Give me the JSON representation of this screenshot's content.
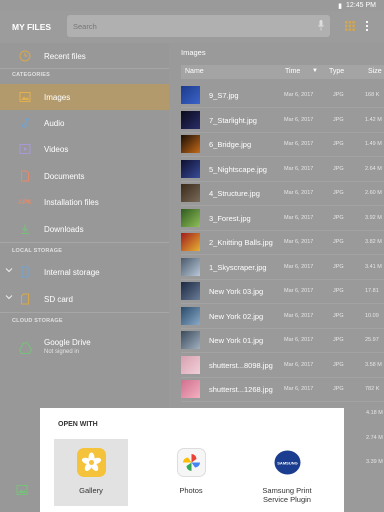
{
  "status": {
    "time": "12:45 PM"
  },
  "appbar": {
    "title": "MY FILES",
    "search_placeholder": "Search"
  },
  "sidebar": {
    "recent": "Recent files",
    "categories_head": "CATEGORIES",
    "categories": [
      "Images",
      "Audio",
      "Videos",
      "Documents",
      "Installation files",
      "Downloads"
    ],
    "apk_label": "APK",
    "local_head": "LOCAL STORAGE",
    "internal": "Internal storage",
    "sdcard": "SD card",
    "cloud_head": "CLOUD STORAGE",
    "gdrive": "Google Drive",
    "gdrive_sub": "Not signed in"
  },
  "main": {
    "breadcrumb": "Images",
    "columns": {
      "name": "Name",
      "time": "Time",
      "type": "Type",
      "size": "Size"
    },
    "files": [
      {
        "name": "9_S7.jpg",
        "date": "Mar 6, 2017",
        "type": "JPG",
        "size": "168 K"
      },
      {
        "name": "7_Starlight.jpg",
        "date": "Mar 6, 2017",
        "type": "JPG",
        "size": "1.42 M"
      },
      {
        "name": "6_Bridge.jpg",
        "date": "Mar 6, 2017",
        "type": "JPG",
        "size": "1.49 M"
      },
      {
        "name": "5_Nightscape.jpg",
        "date": "Mar 6, 2017",
        "type": "JPG",
        "size": "2.64 M"
      },
      {
        "name": "4_Structure.jpg",
        "date": "Mar 6, 2017",
        "type": "JPG",
        "size": "2.60 M"
      },
      {
        "name": "3_Forest.jpg",
        "date": "Mar 6, 2017",
        "type": "JPG",
        "size": "3.92 M"
      },
      {
        "name": "2_Knitting Balls.jpg",
        "date": "Mar 6, 2017",
        "type": "JPG",
        "size": "3.82 M"
      },
      {
        "name": "1_Skyscraper.jpg",
        "date": "Mar 6, 2017",
        "type": "JPG",
        "size": "3.41 M"
      },
      {
        "name": "New York 03.jpg",
        "date": "Mar 6, 2017",
        "type": "JPG",
        "size": "17.81"
      },
      {
        "name": "New York 02.jpg",
        "date": "Mar 6, 2017",
        "type": "JPG",
        "size": "10.09"
      },
      {
        "name": "New York 01.jpg",
        "date": "Mar 6, 2017",
        "type": "JPG",
        "size": "25.97"
      },
      {
        "name": "shutterst...8098.jpg",
        "date": "Mar 6, 2017",
        "type": "JPG",
        "size": "3.58 M"
      },
      {
        "name": "shutterst...1268.jpg",
        "date": "Mar 6, 2017",
        "type": "JPG",
        "size": "782 K"
      }
    ],
    "extra_sizes": [
      "4.18 M",
      "2.74 M",
      "3.39 M"
    ]
  },
  "sheet": {
    "title": "OPEN WITH",
    "options": [
      "Gallery",
      "Photos",
      "Samsung Print Service Plugin"
    ],
    "samsung_logo": "SAMSUNG"
  },
  "colors": {
    "selected": "#b39a6c",
    "accent": "#e8b34a"
  }
}
